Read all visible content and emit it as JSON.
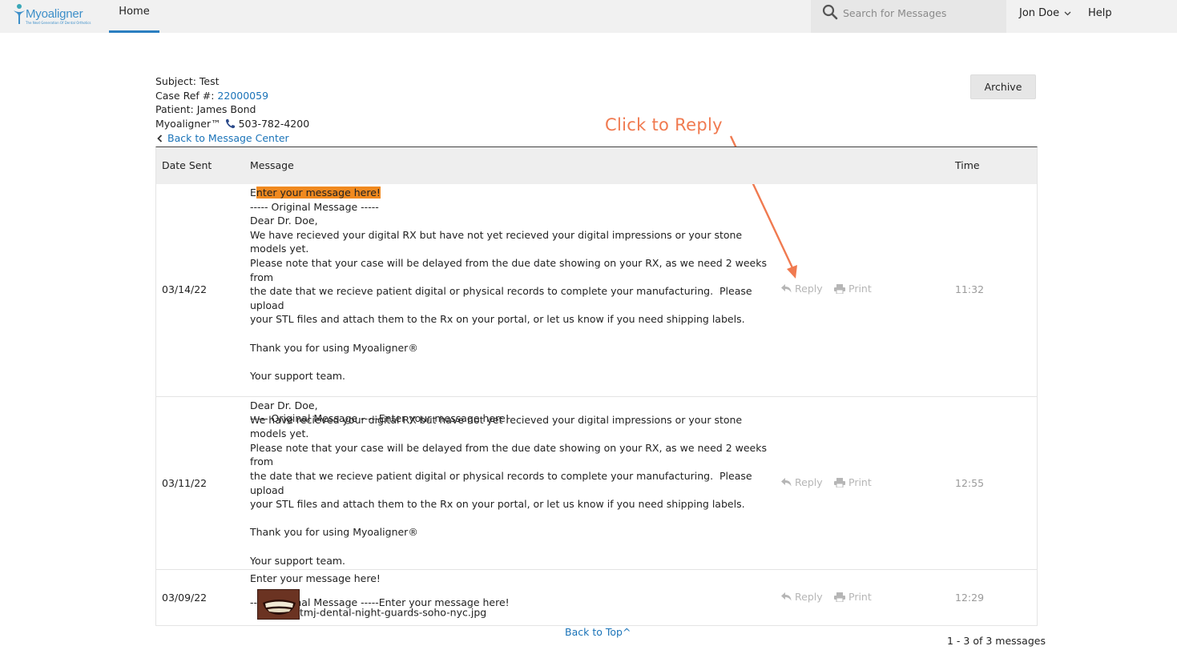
{
  "nav": {
    "logo_text": "Myoaligner",
    "logo_tagline": "The Next Generation Of Dental Orthotics",
    "home_label": "Home",
    "search_placeholder": "Search for Messages",
    "user_name": "Jon Doe",
    "help_label": "Help",
    "icons": {
      "search": "search-icon",
      "user_menu": "chevron-down-icon"
    }
  },
  "header": {
    "subject": "Subject: Test",
    "case_ref_label": "Case Ref #: ",
    "case_ref_value": "22000059",
    "patient": "Patient: James Bond",
    "company": "Myoaligner™",
    "phone": "503-782-4200",
    "back_label": "Back to Message Center",
    "archive_label": "Archive"
  },
  "annotation": {
    "text": "Click to Reply",
    "color": "#f07a50"
  },
  "table": {
    "columns": [
      "Date Sent",
      "Message",
      "Time"
    ],
    "action_labels": {
      "reply": "Reply",
      "print": "Print"
    },
    "rows": [
      {
        "date": "03/14/22",
        "time": "11:32",
        "highlight_first_letter": "E",
        "highlight_rest": "nter your message here!",
        "body": "\n----- Original Message -----\nDear Dr. Doe,\nWe have recieved your digital RX but have not yet recieved your digital impressions or your stone models yet.\nPlease note that your case will be delayed from the due date showing on your RX, as we need 2 weeks from\nthe date that we recieve patient digital or physical records to complete your manufacturing.  Please upload\nyour STL files and attach them to the Rx on your portal, or let us know if you need shipping labels.\n\nThank you for using Myoaligner®\n\nYour support team.\n\n\n----- Original Message -----Enter your message here!"
      },
      {
        "date": "03/11/22",
        "time": "12:55",
        "body": "Dear Dr. Doe,\nWe have recieved your digital RX but have not yet recieved your digital impressions or your stone models yet.\nPlease note that your case will be delayed from the due date showing on your RX, as we need 2 weeks from\nthe date that we recieve patient digital or physical records to complete your manufacturing.  Please upload\nyour STL files and attach them to the Rx on your portal, or let us know if you need shipping labels.\n\nThank you for using Myoaligner®\n\nYour support team.\n\n\n----- Original Message -----Enter your message here!"
      },
      {
        "date": "03/09/22",
        "time": "12:29",
        "body": "Enter your message here!",
        "attachment_name": "tmj-dental-night-guards-soho-nyc.jpg"
      }
    ]
  },
  "footer": {
    "back_to_top": "Back to Top",
    "back_to_top_caret": "^",
    "pager": "1 - 3 of 3 messages"
  },
  "colors": {
    "accent": "#2a7ec0",
    "link": "#1a73b8",
    "highlight": "#f0891f",
    "muted_action": "#b6b6b6"
  }
}
